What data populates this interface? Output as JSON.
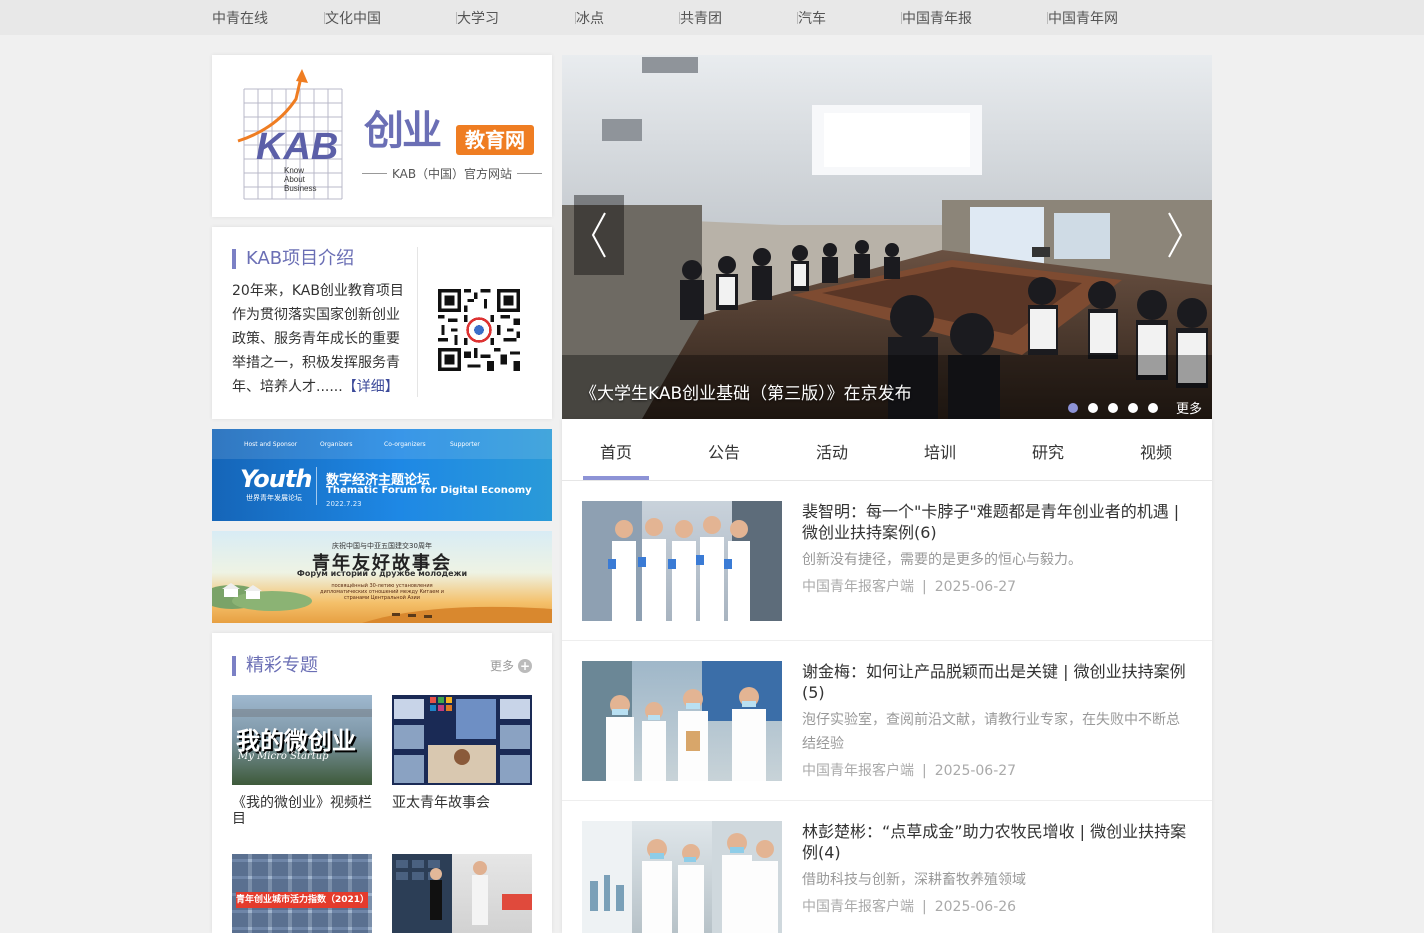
{
  "topnav": [
    "中青在线",
    "文化中国",
    "大学习",
    "冰点",
    "共青团",
    "汽车",
    "中国青年报",
    "中国青年网"
  ],
  "logo": {
    "mark_text": "KAB",
    "mark_words": [
      "Know",
      "About",
      "Business"
    ],
    "title": "创业",
    "badge": "教育网",
    "subtitle": "KAB（中国）官方网站"
  },
  "intro": {
    "title": "KAB项目介绍",
    "text": "20年来，KAB创业教育项目作为贯彻落实国家创新创业政策、服务青年成长的重要举措之一，积极发挥服务青年、培养人才......",
    "more": "【详细】"
  },
  "banner1": {
    "sponsors": [
      "Host and Sponsor",
      "Organizers",
      "Co-organizers",
      "Supporter"
    ],
    "logo_text": "Youth",
    "logo_sub": "世界青年发展论坛",
    "title_cn": "数字经济主题论坛",
    "title_en": "Thematic Forum for Digital Economy",
    "date": "2022.7.23"
  },
  "banner2": {
    "top": "庆祝中国与中亚五国建交30周年",
    "title_cn": "青年友好故事会",
    "title_ru": "Форум историй о дружбе молодежи",
    "sub1": "посвящённый 30-летию установления",
    "sub2": "дипломатических отношений между Китаем и",
    "sub3": "странами Центральной Азии"
  },
  "topics": {
    "title": "精彩专题",
    "more": "更多",
    "items": [
      {
        "caption": "《我的微创业》视频栏目",
        "thumb_text": "我的微创业",
        "thumb_en": "My Micro Startup"
      },
      {
        "caption": "亚太青年故事会"
      },
      {
        "caption": "",
        "thumb_text": "青年创业城市活力指数（2021）"
      },
      {
        "caption": ""
      }
    ]
  },
  "slider": {
    "caption": "《大学生KAB创业基础（第三版）》在京发布",
    "more": "更多",
    "dots": 5,
    "active_dot": 0
  },
  "tabs": [
    "首页",
    "公告",
    "活动",
    "培训",
    "研究",
    "视频"
  ],
  "news": [
    {
      "title": "裴智明：每一个\"卡脖子\"难题都是青年创业者的机遇 | 微创业扶持案例(6)",
      "desc": "创新没有捷径，需要的是更多的恒心与毅力。",
      "source": "中国青年报客户端",
      "sep": "|",
      "date": "2025-06-27"
    },
    {
      "title": "谢金梅：如何让产品脱颖而出是关键 | 微创业扶持案例(5)",
      "desc": "泡仔实验室，查阅前沿文献，请教行业专家，在失败中不断总结经验",
      "source": "中国青年报客户端",
      "sep": "|",
      "date": "2025-06-27"
    },
    {
      "title": "林彭楚彬：“点草成金”助力农牧民增收 | 微创业扶持案例(4)",
      "desc": "借助科技与创新，深耕畜牧养殖领域",
      "source": "中国青年报客户端",
      "sep": "|",
      "date": "2025-06-26"
    }
  ],
  "colors": {
    "accent": "#6b6fb5",
    "badge": "#ef7d22",
    "tab_underline": "#8d93d6"
  }
}
